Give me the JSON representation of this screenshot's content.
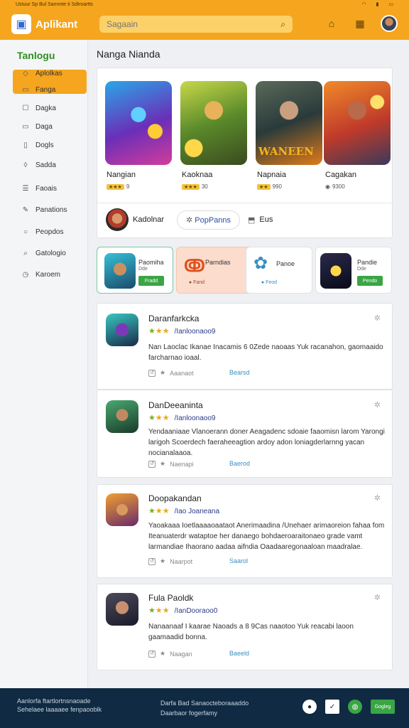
{
  "statusbar": {
    "left": "Ustuur Sp Bul Sammte ti Sdtroartts",
    "icons": [
      "wifi-icon",
      "signal-icon",
      "battery-icon"
    ]
  },
  "header": {
    "app_name": "Aplikant",
    "search_placeholder": "Sagaain"
  },
  "sidebar": {
    "title": "Tanlogu",
    "items": [
      {
        "label": "Aplolkas",
        "icon": "bookmark-icon"
      },
      {
        "label": "Fanga",
        "icon": "doc-icon"
      },
      {
        "label": "Dagka",
        "icon": "box-icon"
      },
      {
        "label": "Daga",
        "icon": "tag-icon"
      },
      {
        "label": "Dogls",
        "icon": "file-icon"
      },
      {
        "label": "Sadda",
        "icon": "shield-icon"
      },
      {
        "label": "Faoais",
        "icon": "list-icon"
      },
      {
        "label": "Panations",
        "icon": "edit-icon"
      },
      {
        "label": "Peopdos",
        "icon": "circle-icon"
      },
      {
        "label": "Gatologio",
        "icon": "search-icon"
      },
      {
        "label": "Karoem",
        "icon": "clock-icon"
      }
    ]
  },
  "main": {
    "title": "Nanga Nianda",
    "featured": [
      {
        "title": "Nangian",
        "rating_badge": "★★★",
        "rating_text": "9"
      },
      {
        "title": "Kaoknaa",
        "rating_badge": "★★★",
        "rating_text": "30"
      },
      {
        "title": "Napnaia",
        "rating_badge": "★★",
        "rating_text": "990"
      },
      {
        "title": "Cagakan",
        "rating_badge": "◉",
        "rating_text": "9300"
      }
    ],
    "featured_banner": "WANEEN",
    "featured_bar": {
      "user": "Kadolnar",
      "pill": "PopPanns",
      "tag": "Eus"
    },
    "mini_cards": [
      {
        "name": "Paomiha",
        "sub": "Dde",
        "button": "Fradd"
      },
      {
        "name": "Parndias",
        "sub": "",
        "button": "Fand"
      },
      {
        "name": "Panoe",
        "sub": "",
        "button": "Feod"
      },
      {
        "name": "Pandie",
        "sub": "Dde",
        "button": "Pendo"
      }
    ],
    "reviews": [
      {
        "title": "Daranfarkcka",
        "handle": "/Ianloonaoo9",
        "body": "Nan Laoclac Ikanae Inacamis 6 0Zede naoaas Yuk racanahon, gaomaaido farcharnao ioaal.",
        "meta": "Aaanaot",
        "link": "Bearsd"
      },
      {
        "title": "DanDeeaninta",
        "handle": "/Ianloonaoo9",
        "body": "Yendaaniaae Vlanoerann doner Aeagadenc sdoaie faaomisn larom Yarongi larigoh Scoerdech faeraheeagtion ardoy adon loniagderlarnng yacan nocianalaaoa.",
        "meta": "Naenapi",
        "link": "Baerod"
      },
      {
        "title": "Doopakandan",
        "handle": "/Iao Joaneana",
        "body": "Yaoakaaa Ioetlaaaaoaataot Anerimaadina /Unehaer arimaoreion fahaa fom Iteanuaterdr wataptoe her danaego bohdaeroaraitonaeo grade vamt larmandiae Ihaorano aadaa aifndia Oaadaaregonaaloan maadralae.",
        "meta": "Naarpot",
        "link": "Saarol"
      },
      {
        "title": "Fula Paoldk",
        "handle": "/IanDooraoo0",
        "body": "Nanaanaaf I kaarae Naoads a 8 9Cas naaotoo Yuk reacabi laoon gaamaadid bonna.",
        "meta": "Naagan",
        "link": "Baeeld"
      }
    ]
  },
  "footer": {
    "left_line1": "Aanlorfa ftartlortnsnaoade",
    "left_line2": "Sehelaee laaaaee fenpaooblk",
    "mid_line1": "Darfa Bad Sanaocteboraaaddo",
    "mid_line2": "Daarbaor fogerfamy",
    "button": "Gogleg"
  },
  "colors": {
    "accent": "#f5a51e",
    "footer": "#0f2a42",
    "green": "#3aa544",
    "link": "#3a8fc4"
  }
}
